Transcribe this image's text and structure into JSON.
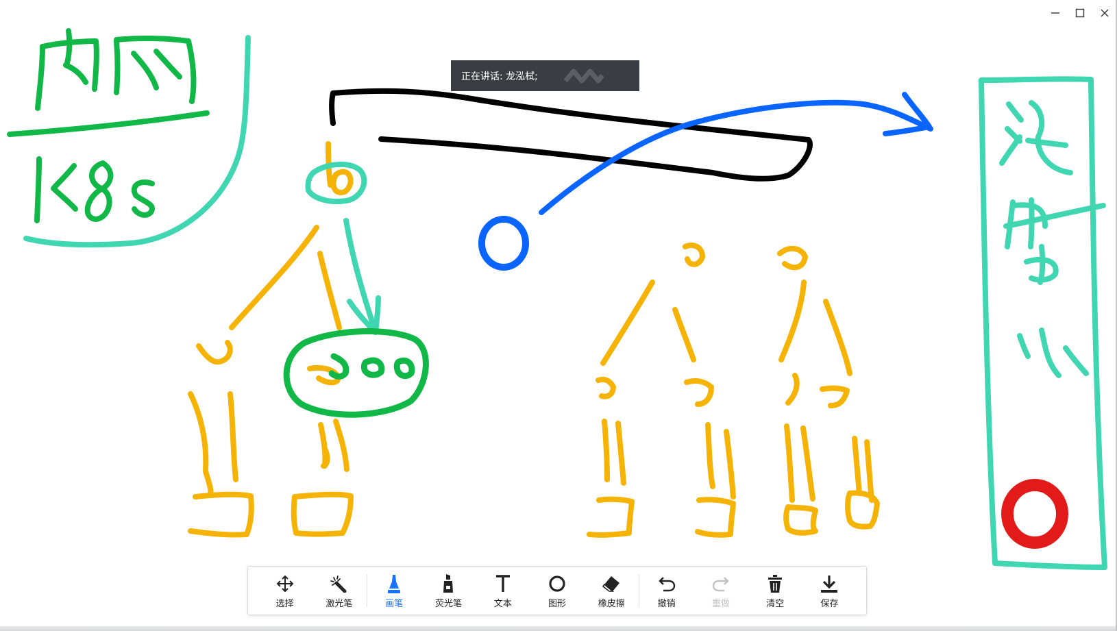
{
  "window": {
    "controls": [
      {
        "name": "minimize-icon",
        "label": "minimize"
      },
      {
        "name": "maximize-icon",
        "label": "maximize"
      },
      {
        "name": "close-icon",
        "label": "close"
      }
    ]
  },
  "speaker": {
    "text": "正在讲话: 龙泓栻;"
  },
  "toolbar": {
    "tools": [
      {
        "id": "select",
        "label": "选择",
        "icon": "move-arrows-icon",
        "state": "normal"
      },
      {
        "id": "laser",
        "label": "激光笔",
        "icon": "laser-wand-icon",
        "state": "normal"
      },
      {
        "id": "pen",
        "label": "画笔",
        "icon": "pen-icon",
        "state": "active"
      },
      {
        "id": "highlighter",
        "label": "荧光笔",
        "icon": "highlighter-icon",
        "state": "normal"
      },
      {
        "id": "text",
        "label": "文本",
        "icon": "text-icon",
        "state": "normal"
      },
      {
        "id": "shape",
        "label": "图形",
        "icon": "circle-shape-icon",
        "state": "normal"
      },
      {
        "id": "eraser",
        "label": "橡皮擦",
        "icon": "eraser-icon",
        "state": "normal"
      },
      {
        "id": "undo",
        "label": "撤销",
        "icon": "undo-icon",
        "state": "normal"
      },
      {
        "id": "redo",
        "label": "重做",
        "icon": "redo-icon",
        "state": "disabled"
      },
      {
        "id": "clear",
        "label": "清空",
        "icon": "trash-icon",
        "state": "normal"
      },
      {
        "id": "save",
        "label": "保存",
        "icon": "download-icon",
        "state": "normal"
      }
    ],
    "active_color": "#1672ff",
    "disabled_color": "#c2c2c2"
  },
  "drawing": {
    "ink_colors": {
      "green": "#11b848",
      "teal": "#40d6b1",
      "orange": "#f5b305",
      "black": "#000000",
      "blue": "#0a64ff",
      "red": "#e21a1a"
    },
    "handwritten_labels": [
      "内网",
      "K8S",
      "注册中心",
      "300"
    ]
  }
}
